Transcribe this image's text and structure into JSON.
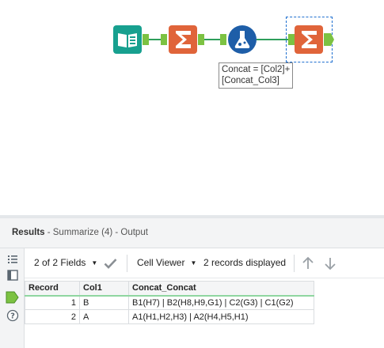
{
  "workflow": {
    "tools": [
      {
        "name": "Input Data",
        "icon": "book-icon",
        "color": "#17a08f"
      },
      {
        "name": "Summarize (2)",
        "icon": "sigma-icon",
        "color": "#e0643a"
      },
      {
        "name": "Formula",
        "icon": "flask-icon",
        "color": "#1e5ea8"
      },
      {
        "name": "Summarize (4)",
        "icon": "sigma-icon",
        "color": "#e0643a",
        "selected": true
      }
    ],
    "annotation_line1": "Concat = [Col2]+",
    "annotation_line2": "[Concat_Col3]"
  },
  "results": {
    "title": "Results",
    "subtitle": " - Summarize (4) - Output",
    "toolbar": {
      "fields_label": "2 of 2 Fields",
      "viewer_label": "Cell Viewer",
      "records_label": "2 records displayed"
    },
    "columns": [
      "Record",
      "Col1",
      "Concat_Concat"
    ],
    "rows": [
      {
        "record": "1",
        "col1": "B",
        "concat": "B1(H7) | B2(H8,H9,G1) | C2(G3) | C1(G2)"
      },
      {
        "record": "2",
        "col1": "A",
        "concat": "A1(H1,H2,H3) | A2(H4,H5,H1)"
      }
    ]
  },
  "colors": {
    "accent_green": "#7cc242",
    "connection": "#2e9e5b",
    "selection": "#1e6fd0"
  }
}
